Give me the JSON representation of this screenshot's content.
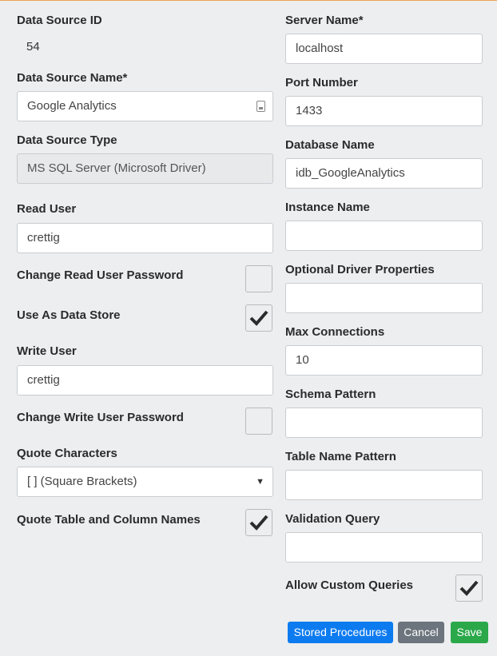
{
  "left": {
    "data_source_id": {
      "label": "Data Source ID",
      "value": "54"
    },
    "data_source_name": {
      "label": "Data Source Name*",
      "value": "Google Analytics"
    },
    "data_source_type": {
      "label": "Data Source Type",
      "value": "MS SQL Server (Microsoft Driver)"
    },
    "read_user": {
      "label": "Read User",
      "value": "crettig"
    },
    "change_read_password": {
      "label": "Change Read User Password",
      "checked": false
    },
    "use_as_data_store": {
      "label": "Use As Data Store",
      "checked": true
    },
    "write_user": {
      "label": "Write User",
      "value": "crettig"
    },
    "change_write_password": {
      "label": "Change Write User Password",
      "checked": false
    },
    "quote_characters": {
      "label": "Quote Characters",
      "value": "[ ] (Square Brackets)"
    },
    "quote_names": {
      "label": "Quote Table and Column Names",
      "checked": true
    }
  },
  "right": {
    "server_name": {
      "label": "Server Name*",
      "value": "localhost"
    },
    "port_number": {
      "label": "Port Number",
      "value": "1433"
    },
    "database_name": {
      "label": "Database Name",
      "value": "idb_GoogleAnalytics"
    },
    "instance_name": {
      "label": "Instance Name",
      "value": ""
    },
    "driver_properties": {
      "label": "Optional Driver Properties",
      "value": ""
    },
    "max_connections": {
      "label": "Max Connections",
      "value": "10"
    },
    "schema_pattern": {
      "label": "Schema Pattern",
      "value": ""
    },
    "table_name_pattern": {
      "label": "Table Name Pattern",
      "value": ""
    },
    "validation_query": {
      "label": "Validation Query",
      "value": ""
    },
    "allow_custom_queries": {
      "label": "Allow Custom Queries",
      "checked": true
    }
  },
  "buttons": {
    "stored_procedures": "Stored Procedures",
    "cancel": "Cancel",
    "save": "Save"
  },
  "colors": {
    "primary": "#0d7bf0",
    "secondary": "#6c757d",
    "success": "#2aa84a",
    "top_border": "#f0a050"
  }
}
